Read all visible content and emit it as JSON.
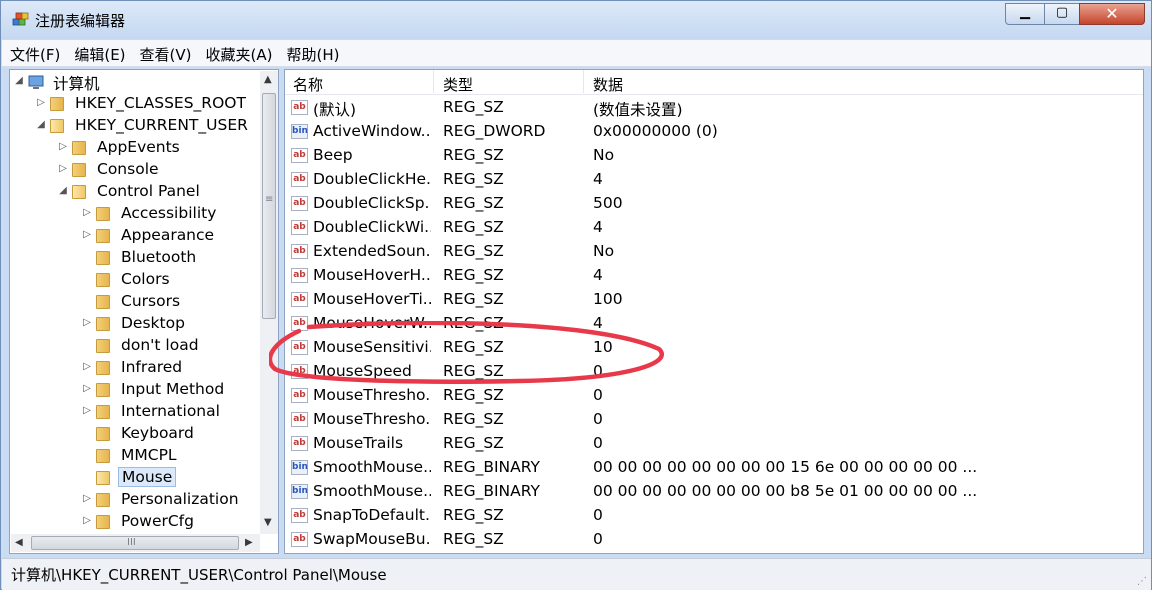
{
  "window": {
    "title": "注册表编辑器",
    "icon": "regedit-icon",
    "min_glyph": "▁",
    "max_glyph": "▢",
    "close_glyph": "✕"
  },
  "menu": [
    "文件(F)",
    "编辑(E)",
    "查看(V)",
    "收藏夹(A)",
    "帮助(H)"
  ],
  "tree": {
    "items": [
      {
        "label": "计算机",
        "level": 0,
        "expander": "◢",
        "icon": "computer-icon"
      },
      {
        "label": "HKEY_CLASSES_ROOT",
        "level": 1,
        "expander": "▷"
      },
      {
        "label": "HKEY_CURRENT_USER",
        "level": 1,
        "expander": "◢"
      },
      {
        "label": "AppEvents",
        "level": 2,
        "expander": "▷"
      },
      {
        "label": "Console",
        "level": 2,
        "expander": "▷"
      },
      {
        "label": "Control Panel",
        "level": 2,
        "expander": "◢"
      },
      {
        "label": "Accessibility",
        "level": 3,
        "expander": "▷"
      },
      {
        "label": "Appearance",
        "level": 3,
        "expander": "▷"
      },
      {
        "label": "Bluetooth",
        "level": 3,
        "expander": ""
      },
      {
        "label": "Colors",
        "level": 3,
        "expander": ""
      },
      {
        "label": "Cursors",
        "level": 3,
        "expander": ""
      },
      {
        "label": "Desktop",
        "level": 3,
        "expander": "▷"
      },
      {
        "label": "don't load",
        "level": 3,
        "expander": ""
      },
      {
        "label": "Infrared",
        "level": 3,
        "expander": "▷"
      },
      {
        "label": "Input Method",
        "level": 3,
        "expander": "▷"
      },
      {
        "label": "International",
        "level": 3,
        "expander": "▷"
      },
      {
        "label": "Keyboard",
        "level": 3,
        "expander": ""
      },
      {
        "label": "MMCPL",
        "level": 3,
        "expander": ""
      },
      {
        "label": "Mouse",
        "level": 3,
        "expander": "",
        "selected": true
      },
      {
        "label": "Personalization",
        "level": 3,
        "expander": "▷"
      },
      {
        "label": "PowerCfg",
        "level": 3,
        "expander": "▷"
      }
    ],
    "scroll_up": "▲",
    "scroll_down": "▼",
    "scroll_left": "◀",
    "scroll_right": "▶",
    "grip_v": "≡",
    "grip_h": "III"
  },
  "list": {
    "columns": [
      "名称",
      "类型",
      "数据"
    ],
    "rows": [
      {
        "name": "(默认)",
        "type": "REG_SZ",
        "data": "(数值未设置)",
        "icon": "ab"
      },
      {
        "name": "ActiveWindow...",
        "type": "REG_DWORD",
        "data": "0x00000000 (0)",
        "icon": "bin"
      },
      {
        "name": "Beep",
        "type": "REG_SZ",
        "data": "No",
        "icon": "ab"
      },
      {
        "name": "DoubleClickHe...",
        "type": "REG_SZ",
        "data": "4",
        "icon": "ab"
      },
      {
        "name": "DoubleClickSp...",
        "type": "REG_SZ",
        "data": "500",
        "icon": "ab"
      },
      {
        "name": "DoubleClickWi...",
        "type": "REG_SZ",
        "data": "4",
        "icon": "ab"
      },
      {
        "name": "ExtendedSoun...",
        "type": "REG_SZ",
        "data": "No",
        "icon": "ab"
      },
      {
        "name": "MouseHoverH...",
        "type": "REG_SZ",
        "data": "4",
        "icon": "ab"
      },
      {
        "name": "MouseHoverTi...",
        "type": "REG_SZ",
        "data": "100",
        "icon": "ab"
      },
      {
        "name": "MouseHoverW...",
        "type": "REG_SZ",
        "data": "4",
        "icon": "ab"
      },
      {
        "name": "MouseSensitivi...",
        "type": "REG_SZ",
        "data": "10",
        "icon": "ab"
      },
      {
        "name": "MouseSpeed",
        "type": "REG_SZ",
        "data": "0",
        "icon": "ab"
      },
      {
        "name": "MouseThresho...",
        "type": "REG_SZ",
        "data": "0",
        "icon": "ab"
      },
      {
        "name": "MouseThresho...",
        "type": "REG_SZ",
        "data": "0",
        "icon": "ab"
      },
      {
        "name": "MouseTrails",
        "type": "REG_SZ",
        "data": "0",
        "icon": "ab"
      },
      {
        "name": "SmoothMouse...",
        "type": "REG_BINARY",
        "data": "00 00 00 00 00 00 00 00 15 6e 00 00 00 00 00 ...",
        "icon": "bin"
      },
      {
        "name": "SmoothMouse...",
        "type": "REG_BINARY",
        "data": "00 00 00 00 00 00 00 00 b8 5e 01 00 00 00 00 ...",
        "icon": "bin"
      },
      {
        "name": "SnapToDefault...",
        "type": "REG_SZ",
        "data": "0",
        "icon": "ab"
      },
      {
        "name": "SwapMouseBu...",
        "type": "REG_SZ",
        "data": "0",
        "icon": "ab"
      }
    ]
  },
  "status": {
    "path": "计算机\\HKEY_CURRENT_USER\\Control Panel\\Mouse",
    "grip": "⋰"
  },
  "annotation_color": "#e8394a"
}
